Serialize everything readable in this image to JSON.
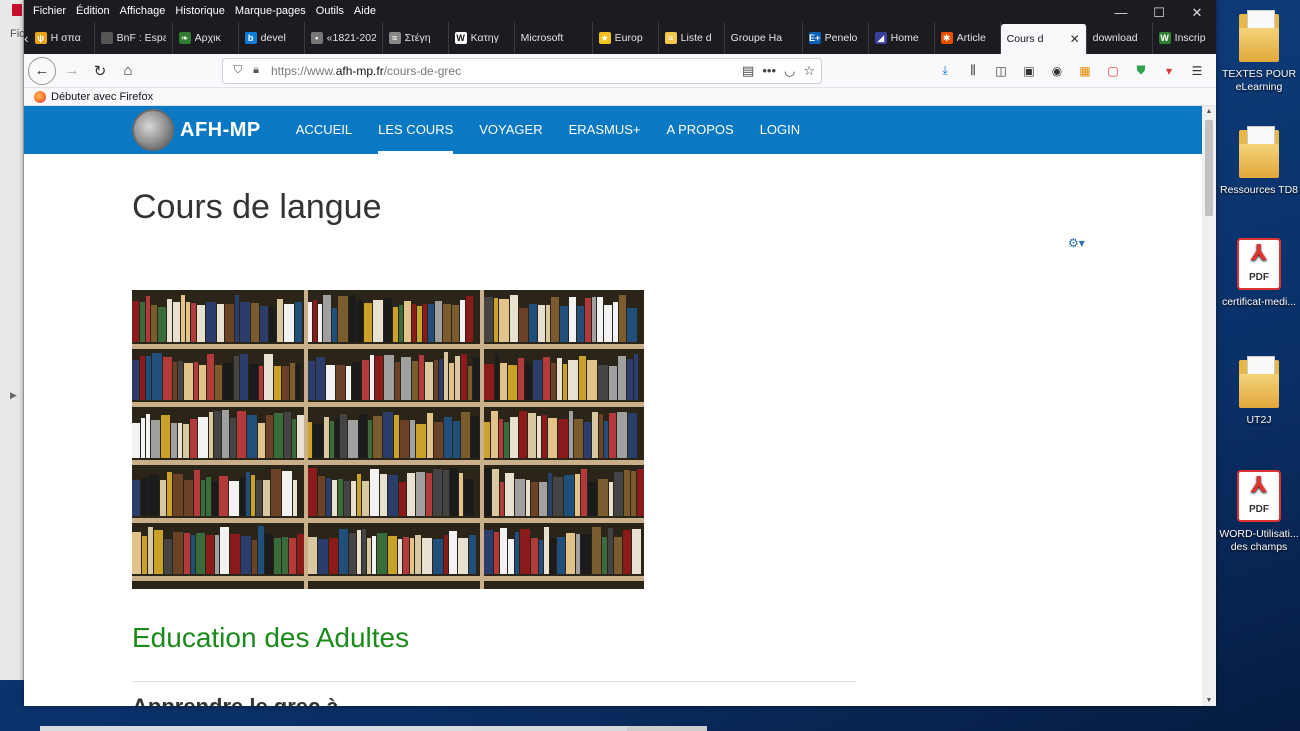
{
  "menu": [
    "Fichier",
    "Édition",
    "Affichage",
    "Historique",
    "Marque-pages",
    "Outils",
    "Aide"
  ],
  "bg_app": {
    "label": "Fic"
  },
  "tabs": [
    {
      "label": "Η σπα",
      "color": "#e8a317",
      "icon": "fork-icon"
    },
    {
      "label": "BnF : Espa",
      "color": "#555555",
      "icon": "bnf-icon"
    },
    {
      "label": "Αρχικ",
      "color": "#2e7d32",
      "icon": "leaf-icon"
    },
    {
      "label": "devel",
      "color": "#0f7bd8",
      "icon": "b-icon"
    },
    {
      "label": "«1821-202",
      "color": "#777777",
      "icon": "doc-icon"
    },
    {
      "label": "Στέγη",
      "color": "#888888",
      "icon": "wave-icon"
    },
    {
      "label": "Κατηγ",
      "color": "#ffffff",
      "icon": "w-icon"
    },
    {
      "label": "Microsoft",
      "color": "#1c1b22",
      "icon": "none"
    },
    {
      "label": "Europ",
      "color": "#f0c419",
      "icon": "star-icon"
    },
    {
      "label": "Liste d",
      "color": "#f2c94c",
      "icon": "list-icon"
    },
    {
      "label": "Groupe Ha",
      "color": "#1c1b22",
      "icon": "none"
    },
    {
      "label": "Penelo",
      "color": "#0a5fb4",
      "icon": "eplus-icon"
    },
    {
      "label": "Home",
      "color": "#3a3f9a",
      "icon": "home-tab-icon"
    },
    {
      "label": "Article",
      "color": "#e65100",
      "icon": "joomla-icon"
    },
    {
      "label": "Cours d",
      "color": "#ffffff",
      "icon": "none",
      "active": true
    },
    {
      "label": "download",
      "color": "#1c1b22",
      "icon": "none"
    },
    {
      "label": "Inscrip",
      "color": "#2e7d32",
      "icon": "w-green-icon"
    }
  ],
  "url": {
    "prefix": "https://www.",
    "domain": "afh-mp.fr",
    "path": "/cours-de-grec"
  },
  "bookmarks": [
    {
      "label": "Débuter avec Firefox"
    }
  ],
  "site": {
    "logo_text": "AFH-MP",
    "nav": [
      {
        "label": "ACCUEIL"
      },
      {
        "label": "LES COURS",
        "active": true
      },
      {
        "label": "VOYAGER"
      },
      {
        "label": "ERASMUS+"
      },
      {
        "label": "A PROPOS"
      },
      {
        "label": "LOGIN"
      }
    ],
    "page_title": "Cours de langue",
    "section_title": "Education des Adultes",
    "subhead": "Apprendre le grec à ..."
  },
  "desktop_icons": [
    {
      "label": "TEXTES POUR eLearning",
      "type": "folder"
    },
    {
      "label": "Ressources TD8",
      "type": "folder"
    },
    {
      "label": "certificat-medi...",
      "type": "pdf"
    },
    {
      "label": "UT2J",
      "type": "folder"
    },
    {
      "label": "WORD-Utilisati... des champs",
      "type": "pdf"
    }
  ],
  "icon_texts": {
    "pdf": "PDF",
    "w_tab": "W",
    "eplus_tab": "E+",
    "b_tab": "b"
  },
  "colors": {
    "site_nav": "#0a78c2",
    "section_title": "#1a8a1a",
    "firefox_chrome": "#1c1b22"
  }
}
